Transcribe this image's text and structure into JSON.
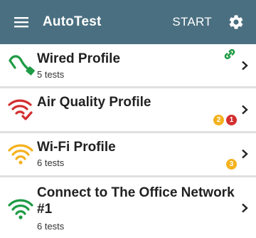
{
  "appbar": {
    "title": "AutoTest",
    "start_label": "START",
    "menu_icon": "hamburger-menu-icon",
    "settings_icon": "gear-icon",
    "background": "#4a6f80"
  },
  "profiles": [
    {
      "title": "Wired Profile",
      "subtitle": "5 tests",
      "icon": "ethernet-cable-icon",
      "status_icon": "link-icon"
    },
    {
      "title": "Air Quality Profile",
      "subtitle": "",
      "icon": "wifi-check-icon",
      "badges": [
        {
          "count": "2",
          "color": "#f5b21e"
        },
        {
          "count": "1",
          "color": "#d32f2f"
        }
      ]
    },
    {
      "title": "Wi-Fi Profile",
      "subtitle": "6 tests",
      "icon": "wifi-icon",
      "badges": [
        {
          "count": "3",
          "color": "#f5b21e"
        }
      ]
    },
    {
      "title_line1": "Connect to The Office Network",
      "title_line2": "#1",
      "subtitle": "6 tests",
      "icon": "wifi-icon"
    }
  ],
  "colors": {
    "green": "#1e9b45",
    "red": "#d32f2f",
    "yellow": "#f5b21e"
  }
}
